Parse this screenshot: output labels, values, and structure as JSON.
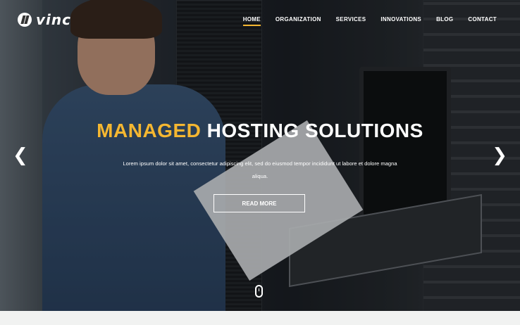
{
  "brand": {
    "name": "vinc"
  },
  "nav": {
    "items": [
      {
        "label": "HOME",
        "active": true
      },
      {
        "label": "ORGANIZATION",
        "active": false
      },
      {
        "label": "SERVICES",
        "active": false
      },
      {
        "label": "INNOVATIONS",
        "active": false
      },
      {
        "label": "BLOG",
        "active": false
      },
      {
        "label": "CONTACT",
        "active": false
      }
    ]
  },
  "hero": {
    "headline_accent": "MANAGED",
    "headline_rest": "HOSTING SOLUTIONS",
    "description": "Lorem ipsum dolor sit amet, consectetur adipiscing elit, sed do eiusmod tempor incididunt ut labore et dolore magna aliqua.",
    "cta_label": "READ MORE",
    "prev_icon": "chevron-left-icon",
    "next_icon": "chevron-right-icon",
    "scroll_icon": "mouse-scroll-icon"
  },
  "colors": {
    "accent": "#f5b731",
    "text": "#ffffff"
  }
}
